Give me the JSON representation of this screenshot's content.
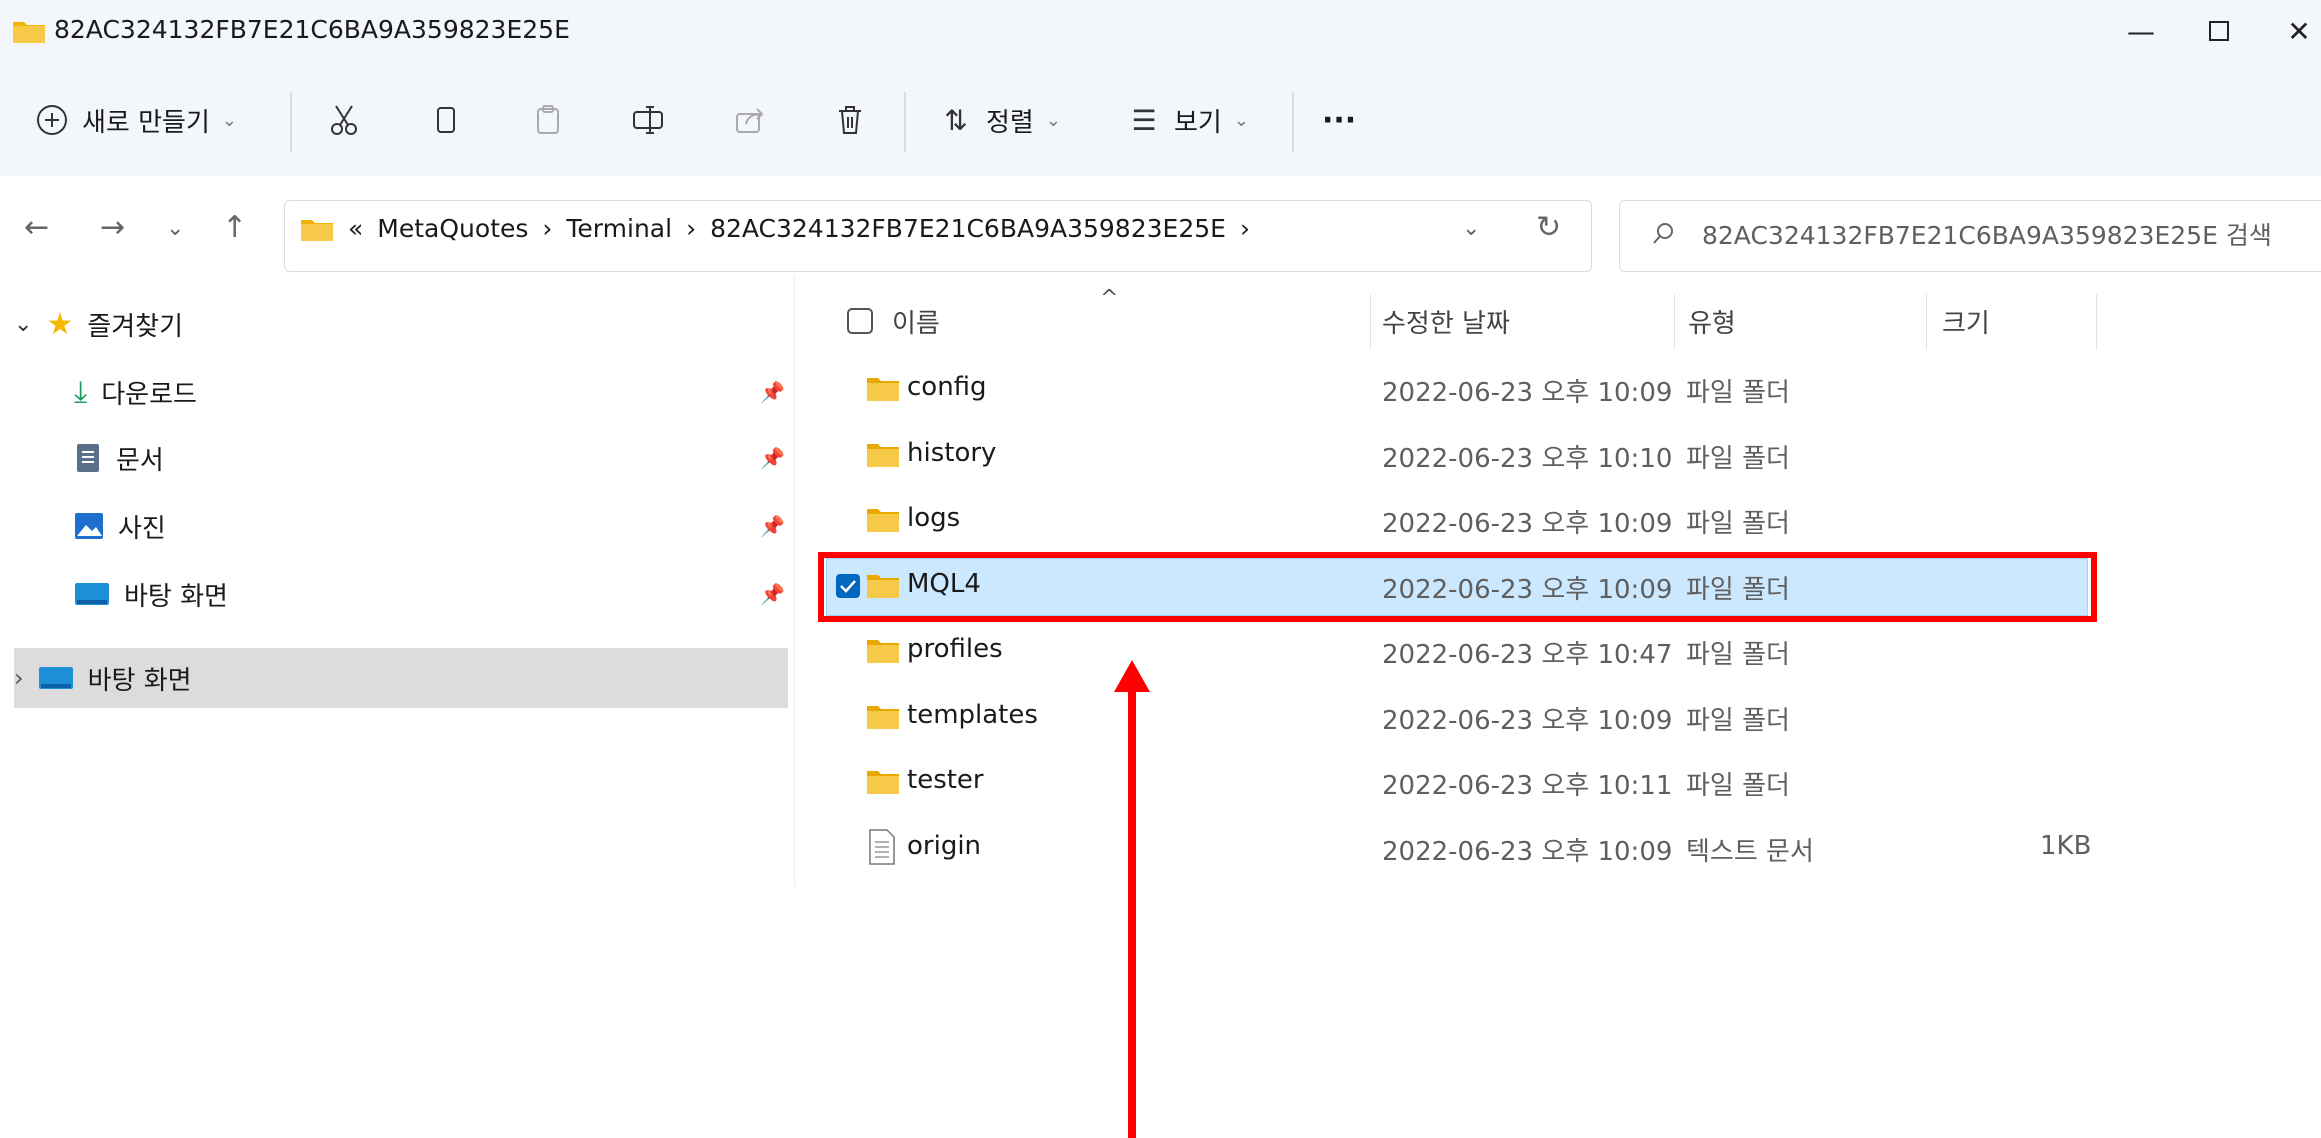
{
  "window": {
    "title": "82AC324132FB7E21C6BA9A359823E25E"
  },
  "toolbar": {
    "new_label": "새로 만들기",
    "sort_label": "정렬",
    "view_label": "보기",
    "more_label": "···"
  },
  "address": {
    "overflow": "«",
    "crumbs": [
      "MetaQuotes",
      "Terminal",
      "82AC324132FB7E21C6BA9A359823E25E"
    ],
    "separator": "›"
  },
  "search": {
    "placeholder": "82AC324132FB7E21C6BA9A359823E25E 검색"
  },
  "sidebar": {
    "favorites_label": "즐겨찾기",
    "items": [
      {
        "label": "다운로드",
        "icon": "download-icon"
      },
      {
        "label": "문서",
        "icon": "document-icon"
      },
      {
        "label": "사진",
        "icon": "picture-icon"
      },
      {
        "label": "바탕 화면",
        "icon": "desktop-icon"
      }
    ],
    "desktop_root_label": "바탕 화면"
  },
  "columns": {
    "name": "이름",
    "date": "수정한 날짜",
    "type": "유형",
    "size": "크기"
  },
  "files": [
    {
      "name": "config",
      "date": "2022-06-23 오후 10:09",
      "type": "파일 폴더",
      "size": "",
      "kind": "folder"
    },
    {
      "name": "history",
      "date": "2022-06-23 오후 10:10",
      "type": "파일 폴더",
      "size": "",
      "kind": "folder"
    },
    {
      "name": "logs",
      "date": "2022-06-23 오후 10:09",
      "type": "파일 폴더",
      "size": "",
      "kind": "folder"
    },
    {
      "name": "MQL4",
      "date": "2022-06-23 오후 10:09",
      "type": "파일 폴더",
      "size": "",
      "kind": "folder",
      "selected": true
    },
    {
      "name": "profiles",
      "date": "2022-06-23 오후 10:47",
      "type": "파일 폴더",
      "size": "",
      "kind": "folder"
    },
    {
      "name": "templates",
      "date": "2022-06-23 오후 10:09",
      "type": "파일 폴더",
      "size": "",
      "kind": "folder"
    },
    {
      "name": "tester",
      "date": "2022-06-23 오후 10:11",
      "type": "파일 폴더",
      "size": "",
      "kind": "folder"
    },
    {
      "name": "origin",
      "date": "2022-06-23 오후 10:09",
      "type": "텍스트 문서",
      "size": "1KB",
      "kind": "text-file"
    }
  ],
  "colors": {
    "selection_bg": "#cce8ff",
    "annotation_red": "#ff0000",
    "folder_yellow": "#f7c948",
    "accent": "#0067c0"
  }
}
